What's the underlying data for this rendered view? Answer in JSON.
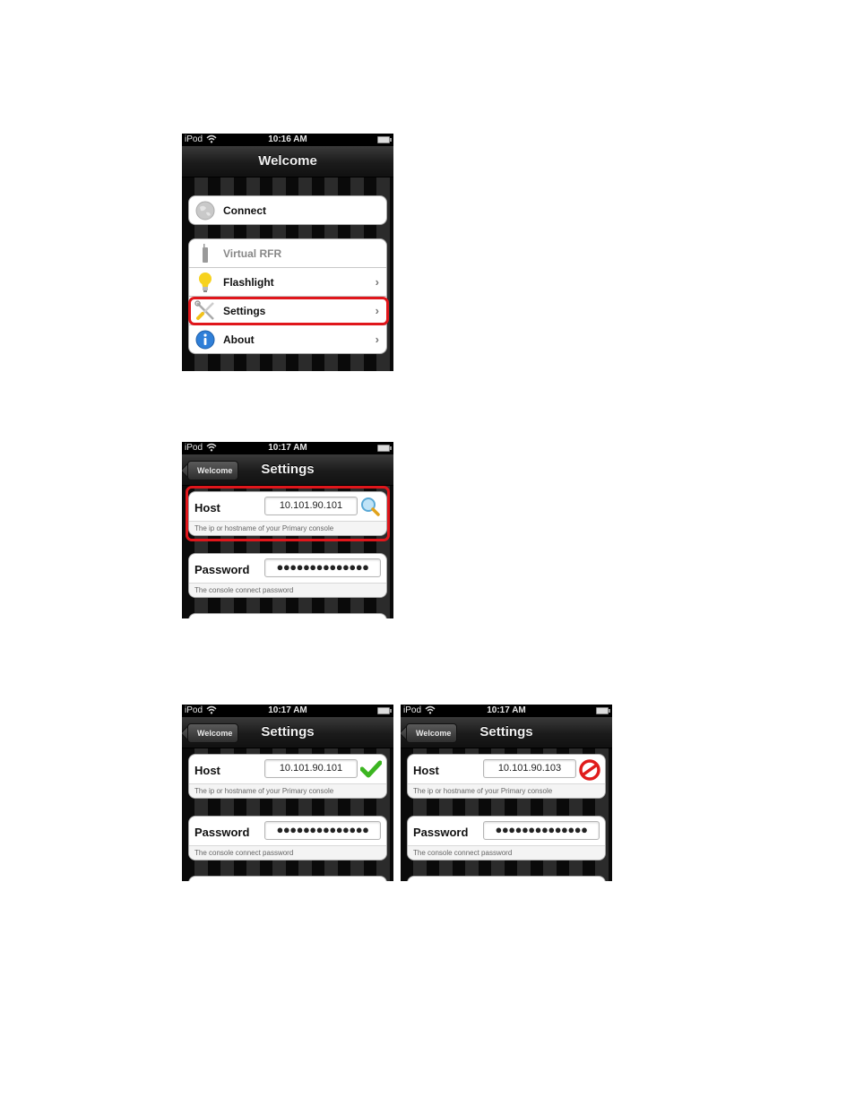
{
  "screens": [
    {
      "id": "welcome",
      "status_bar": {
        "carrier": "iPod",
        "wifi_icon": "wifi-icon",
        "time": "10:16 AM",
        "battery_icon": "battery-icon"
      },
      "nav": {
        "title": "Welcome"
      },
      "groups": [
        {
          "items": [
            {
              "label": "Connect",
              "icon": "globe-icon",
              "enabled": false,
              "chevron": false
            }
          ]
        },
        {
          "items": [
            {
              "label": "Virtual RFR",
              "icon": "remote-icon",
              "enabled": false,
              "chevron": false
            },
            {
              "label": "Flashlight",
              "icon": "lightbulb-icon",
              "enabled": true,
              "chevron": true
            },
            {
              "label": "Settings",
              "icon": "tools-icon",
              "enabled": true,
              "chevron": true,
              "highlighted": true
            },
            {
              "label": "About",
              "icon": "info-icon",
              "enabled": true,
              "chevron": true
            }
          ]
        }
      ]
    },
    {
      "id": "settings-searching",
      "status_bar": {
        "carrier": "iPod",
        "wifi_icon": "wifi-icon",
        "time": "10:17 AM",
        "battery_icon": "battery-icon"
      },
      "nav": {
        "title": "Settings",
        "back_label": "Welcome"
      },
      "host": {
        "label": "Host",
        "value": "10.101.90.101",
        "hint": "The ip or hostname of your Primary console",
        "status_icon": "magnifier-icon",
        "highlighted": true
      },
      "password": {
        "label": "Password",
        "value": "●●●●●●●●●●●●●●",
        "hint": "The console connect password"
      }
    },
    {
      "id": "settings-connected",
      "status_bar": {
        "carrier": "iPod",
        "wifi_icon": "wifi-icon",
        "time": "10:17 AM",
        "battery_icon": "battery-icon"
      },
      "nav": {
        "title": "Settings",
        "back_label": "Welcome"
      },
      "host": {
        "label": "Host",
        "value": "10.101.90.101",
        "hint": "The ip or hostname of your Primary console",
        "status_icon": "checkmark-icon"
      },
      "password": {
        "label": "Password",
        "value": "●●●●●●●●●●●●●●",
        "hint": "The console connect password"
      }
    },
    {
      "id": "settings-failed",
      "status_bar": {
        "carrier": "iPod",
        "wifi_icon": "wifi-icon",
        "time": "10:17 AM",
        "battery_icon": "battery-icon"
      },
      "nav": {
        "title": "Settings",
        "back_label": "Welcome"
      },
      "host": {
        "label": "Host",
        "value": "10.101.90.103",
        "hint": "The ip or hostname of your Primary console",
        "status_icon": "prohibited-icon"
      },
      "password": {
        "label": "Password",
        "value": "●●●●●●●●●●●●●●",
        "hint": "The console connect password"
      }
    }
  ],
  "colors": {
    "highlight": "#e0161b",
    "check": "#3cb521",
    "error": "#e01b1b",
    "info": "#2f7fd8"
  }
}
